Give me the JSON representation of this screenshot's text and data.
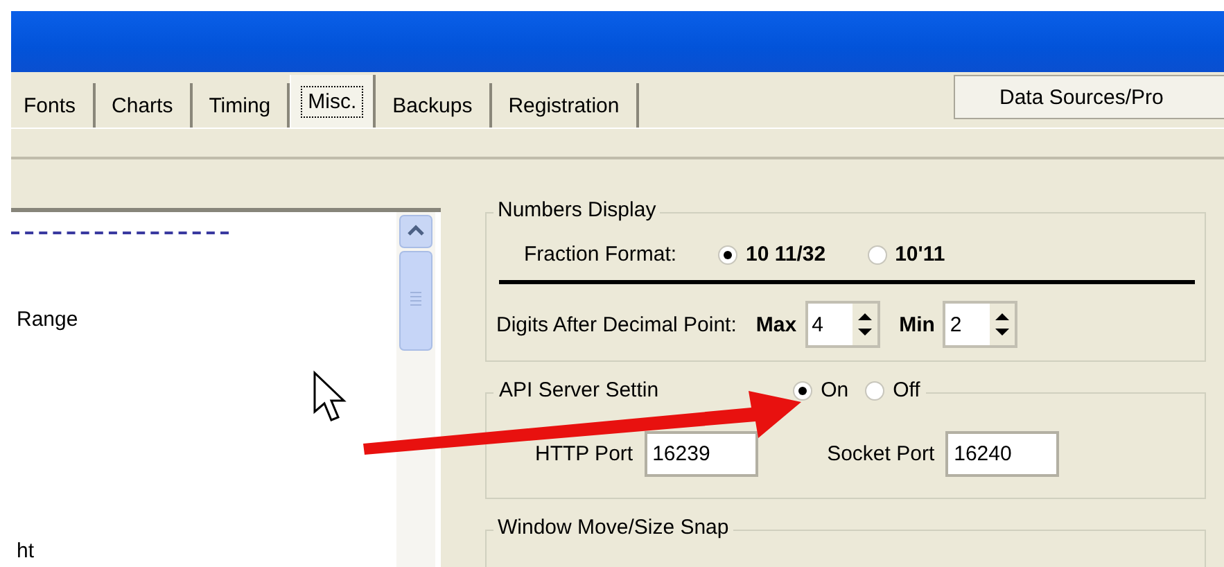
{
  "tabs": [
    {
      "label": "Fonts",
      "selected": false
    },
    {
      "label": "Charts",
      "selected": false
    },
    {
      "label": "Timing",
      "selected": false
    },
    {
      "label": "Misc.",
      "selected": true
    },
    {
      "label": "Backups",
      "selected": false
    },
    {
      "label": "Registration",
      "selected": false
    }
  ],
  "top_button": "Data Sources/Pro",
  "list": {
    "items": [
      "Range",
      "ht"
    ]
  },
  "numbers_display": {
    "title": "Numbers Display",
    "fraction_label": "Fraction Format:",
    "fraction_options": [
      {
        "label": "10 11/32",
        "selected": true
      },
      {
        "label": "10'11",
        "selected": false
      }
    ],
    "digits_label": "Digits After Decimal Point:",
    "spinners": [
      {
        "label": "Max",
        "value": "4"
      },
      {
        "label": "Min",
        "value": "2"
      }
    ]
  },
  "api_server": {
    "title": "API Server Settin",
    "options": [
      {
        "label": "On",
        "selected": true
      },
      {
        "label": "Off",
        "selected": false
      }
    ],
    "fields": [
      {
        "label": "HTTP Port",
        "value": "16239"
      },
      {
        "label": "Socket Port",
        "value": "16240"
      }
    ]
  },
  "snap_group": {
    "title": "Window Move/Size Snap"
  }
}
